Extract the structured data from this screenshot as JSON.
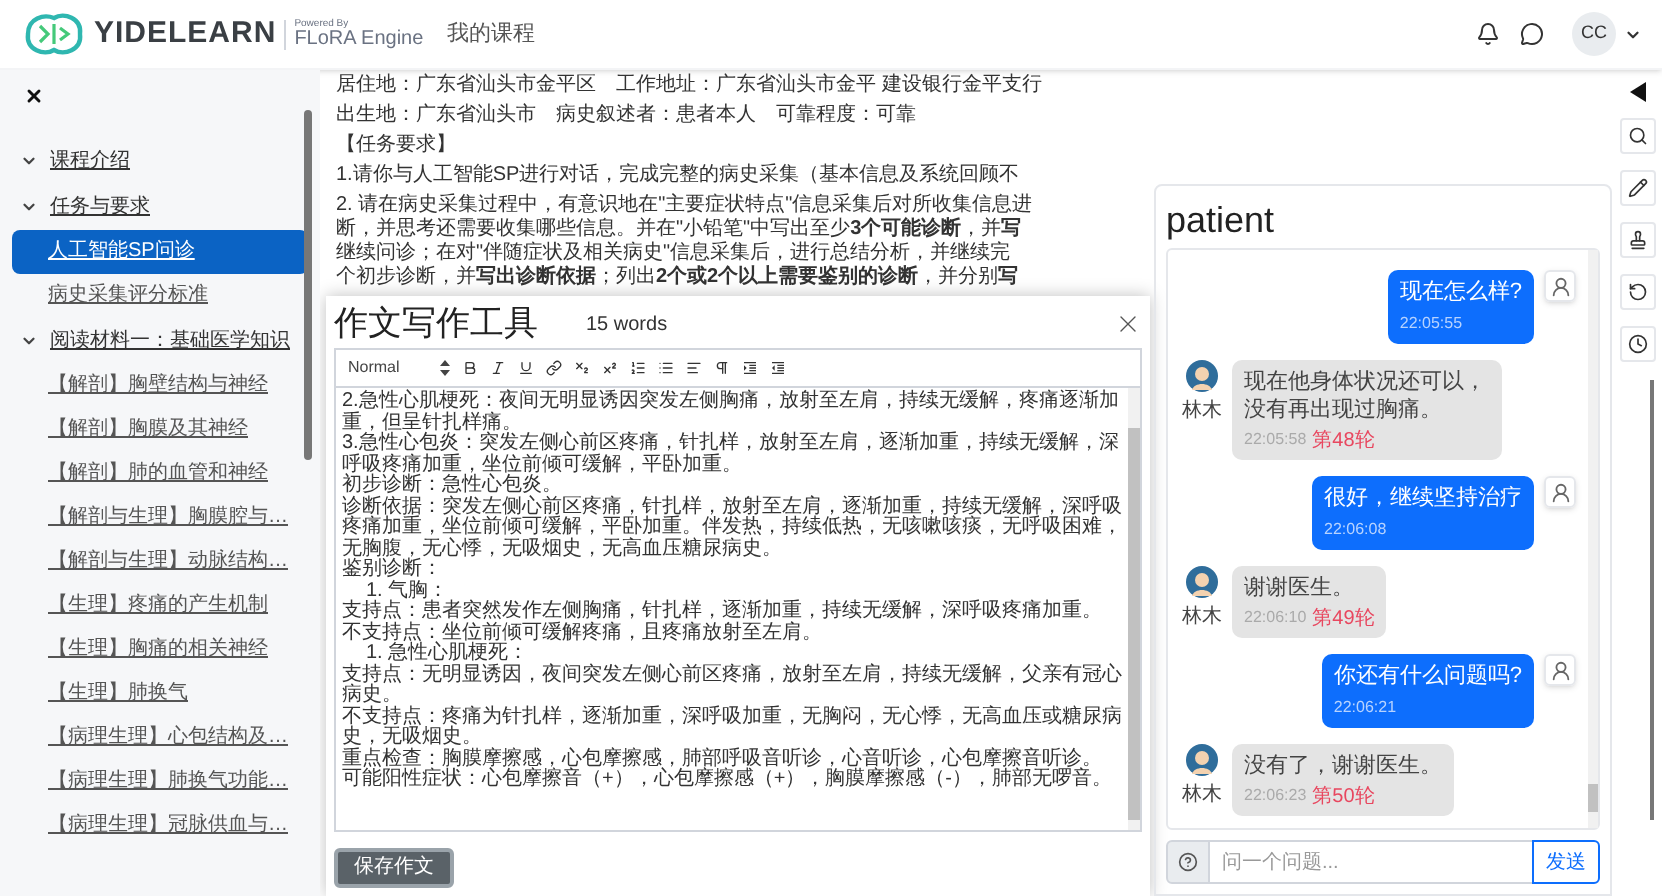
{
  "header": {
    "brand": "YIDELEARN",
    "powered_by": "Powered By",
    "engine": "FLoRA Engine",
    "nav_link": "我的课程",
    "avatar": "CC"
  },
  "sidebar": {
    "items": [
      {
        "label": "课程介绍",
        "expanded": true
      },
      {
        "label": "任务与要求",
        "expanded": true,
        "children": [
          {
            "label": "人工智能SP问诊",
            "selected": true
          },
          {
            "label": "病史采集评分标准",
            "selected": false
          }
        ]
      },
      {
        "label": "阅读材料一：基础医学知识",
        "expanded": true,
        "children": [
          {
            "label": "【解剖】胸壁结构与神经",
            "selected": false
          },
          {
            "label": "【解剖】胸膜及其神经",
            "selected": false
          },
          {
            "label": "【解剖】肺的血管和神经",
            "selected": false
          },
          {
            "label": "【解剖与生理】胸膜腔与…",
            "selected": false
          },
          {
            "label": "【解剖与生理】动脉结构…",
            "selected": false
          },
          {
            "label": "【生理】疼痛的产生机制",
            "selected": false
          },
          {
            "label": "【生理】胸痛的相关神经",
            "selected": false
          },
          {
            "label": "【生理】肺换气",
            "selected": false
          },
          {
            "label": "【病理生理】心包结构及…",
            "selected": false
          },
          {
            "label": "【病理生理】肺换气功能…",
            "selected": false
          },
          {
            "label": "【病理生理】冠脉供血与…",
            "selected": false
          }
        ]
      }
    ]
  },
  "passage": {
    "paragraphs": [
      {
        "lines": [
          "居住地：广东省汕头市金平区　工作地址：广东省汕头市金平 建设银行金平支行"
        ]
      },
      {
        "lines": [
          "出生地：广东省汕头市　病史叙述者：患者本人　可靠程度：可靠"
        ]
      },
      {
        "lines": [
          "【任务要求】"
        ]
      },
      {
        "lines": [
          "1.请你与人工智能SP进行对话，完成完整的病史采集（基本信息及系统回顾不"
        ]
      },
      {
        "lines": [
          "2. 请在病史采集过程中，有意识地在\"主要症状特点\"信息采集后对所收集信息进",
          "断，并思考还需要收集哪些信息。并在\"小铅笔\"中写出至少**3个可能诊断**，并**写**",
          "继续问诊；在对\"伴随症状及相关病史\"信息采集后，进行总结分析，并继续完",
          "个初步诊断，并**写出诊断依据**；列出**2个或2个以上需要鉴别的诊断**，并分别**写**"
        ]
      }
    ]
  },
  "editor": {
    "title": "作文写作工具",
    "word_count": "15 words",
    "format_select": "Normal",
    "lines": [
      {
        "kind": "text",
        "text": "2.急性心肌梗死：夜间无明显诱因突发左侧胸痛，放射至左肩，持续无缓解，疼痛逐渐加重，但呈针扎样痛。"
      },
      {
        "kind": "text",
        "text": "3.急性心包炎：突发左侧心前区疼痛，针扎样，放射至左肩，逐渐加重，持续无缓解，深呼吸疼痛加重，坐位前倾可缓解，平卧加重。"
      },
      {
        "kind": "text",
        "text": "初步诊断：急性心包炎。"
      },
      {
        "kind": "text",
        "text": "诊断依据：突发左侧心前区疼痛，针扎样，放射至左肩，逐渐加重，持续无缓解，深呼吸疼痛加重，坐位前倾可缓解，平卧加重。伴发热，持续低热，无咳嗽咳痰，无呼吸困难，无胸腹，无心悸，无吸烟史，无高血压糖尿病史。"
      },
      {
        "kind": "text",
        "text": "鉴别诊断："
      },
      {
        "kind": "indent",
        "text": "1. 气胸："
      },
      {
        "kind": "text",
        "text": "支持点：患者突然发作左侧胸痛，针扎样，逐渐加重，持续无缓解，深呼吸疼痛加重。"
      },
      {
        "kind": "text",
        "text": "不支持点：坐位前倾可缓解疼痛，且疼痛放射至左肩。"
      },
      {
        "kind": "indent",
        "text": "1. 急性心肌梗死："
      },
      {
        "kind": "text",
        "text": "支持点：无明显诱因，夜间突发左侧心前区疼痛，放射至左肩，持续无缓解，父亲有冠心病史。"
      },
      {
        "kind": "text",
        "text": "不支持点：疼痛为针扎样，逐渐加重，深呼吸加重，无胸闷，无心悸，无高血压或糖尿病史，无吸烟史。"
      },
      {
        "kind": "text",
        "text": "重点检查：胸膜摩擦感，心包摩擦感，肺部呼吸音听诊，心音听诊，心包摩擦音听诊。"
      },
      {
        "kind": "text",
        "text": "可能阳性症状：心包摩擦音（+），心包摩擦感（+），胸膜摩擦感（-），肺部无啰音。"
      }
    ],
    "save_button": "保存作文"
  },
  "chat": {
    "title": "patient",
    "messages": [
      {
        "kind": "sent",
        "text": "现在怎么样?",
        "time": "22:05:55"
      },
      {
        "kind": "received",
        "name": "林木",
        "text": "现在他身体状况还可以，没有再出现过胸痛。",
        "time": "22:05:58",
        "round": "第48轮"
      },
      {
        "kind": "sent",
        "text": "很好，继续坚持治疗",
        "time": "22:06:08"
      },
      {
        "kind": "received",
        "name": "林木",
        "text": "谢谢医生。",
        "time": "22:06:10",
        "round": "第49轮"
      },
      {
        "kind": "sent",
        "text": "你还有什么问题吗?",
        "time": "22:06:21"
      },
      {
        "kind": "received",
        "name": "林木",
        "text": "没有了，谢谢医生。",
        "time": "22:06:23",
        "round": "第50轮"
      }
    ],
    "input": {
      "placeholder": "问一个问题..."
    },
    "send_button": "发送"
  }
}
